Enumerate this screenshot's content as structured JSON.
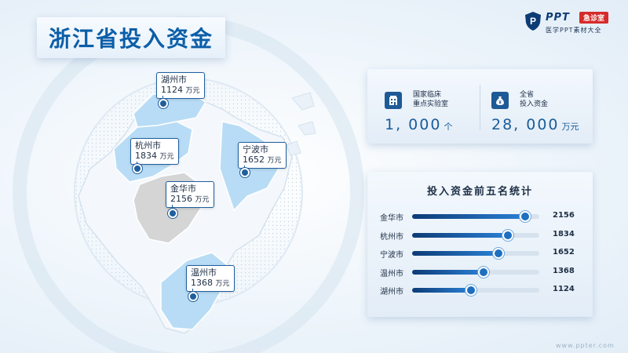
{
  "title": "浙江省投入资金",
  "logo": {
    "brand": "PPT",
    "tag": "急诊室",
    "sub": "医学PPT素材大全"
  },
  "map": {
    "cities": [
      {
        "name": "湖州市",
        "value": "1124",
        "unit": "万元"
      },
      {
        "name": "杭州市",
        "value": "1834",
        "unit": "万元"
      },
      {
        "name": "宁波市",
        "value": "1652",
        "unit": "万元"
      },
      {
        "name": "金华市",
        "value": "2156",
        "unit": "万元"
      },
      {
        "name": "温州市",
        "value": "1368",
        "unit": "万元"
      }
    ]
  },
  "stats": [
    {
      "icon": "building-icon",
      "label_line1": "国家临床",
      "label_line2": "重点实验室",
      "value": "1, 000",
      "unit": "个"
    },
    {
      "icon": "money-bag-icon",
      "label_line1": "全省",
      "label_line2": "投入资金",
      "value": "28, 000",
      "unit": "万元"
    }
  ],
  "ranking": {
    "title": "投入资金前五名统计",
    "max": 2156,
    "rows": [
      {
        "city": "金华市",
        "value": 2156
      },
      {
        "city": "杭州市",
        "value": 1834
      },
      {
        "city": "宁波市",
        "value": 1652
      },
      {
        "city": "温州市",
        "value": 1368
      },
      {
        "city": "湖州市",
        "value": 1124
      }
    ]
  },
  "footer": "www.ppter.com",
  "colors": {
    "accent": "#0b5ea8",
    "highlight_region": "#b8dcf5",
    "selected_region": "#d5d5d5",
    "bar_dark": "#0d3b76",
    "bar_light": "#2a7fd4"
  }
}
